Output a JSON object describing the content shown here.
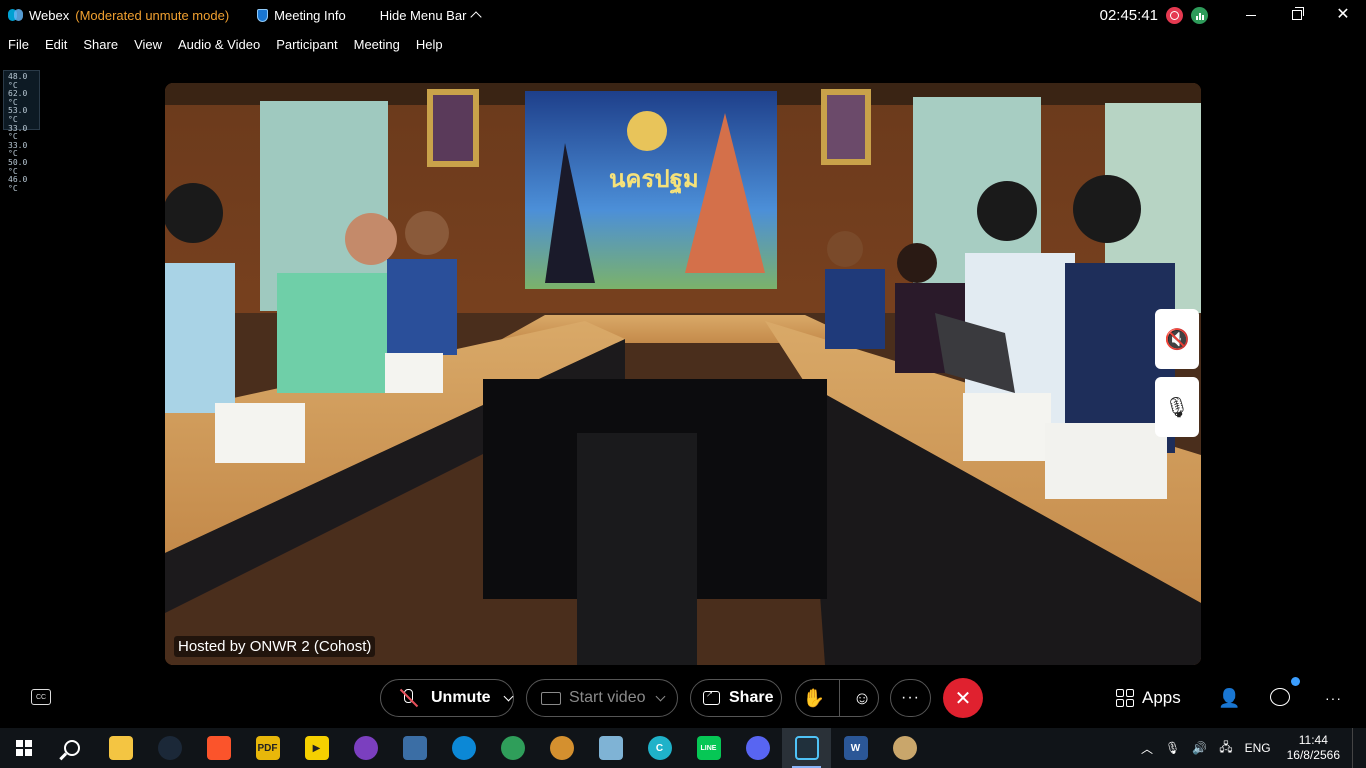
{
  "titlebar": {
    "app_name": "Webex",
    "mode": "(Moderated unmute mode)",
    "meeting_info": "Meeting Info",
    "hide_menu": "Hide Menu Bar",
    "clock": "02:45:41"
  },
  "menu": [
    "File",
    "Edit",
    "Share",
    "View",
    "Audio & Video",
    "Participant",
    "Meeting",
    "Help"
  ],
  "temps": [
    "48.0 °C",
    "62.0 °C",
    "53.0 °C",
    "33.0 °C",
    "33.0 °C",
    "50.0 °C",
    "46.0 °C"
  ],
  "video": {
    "host_label": "Hosted by ONWR 2 (Cohost)",
    "banner_text": "นครปฐม"
  },
  "controls": {
    "unmute": "Unmute",
    "start_video": "Start video",
    "share": "Share",
    "more": "···",
    "apps": "Apps",
    "more_right": "···"
  },
  "taskbar": {
    "apps": [
      {
        "name": "file-explorer",
        "color": "#f4c542"
      },
      {
        "name": "steam",
        "color": "#1b2838"
      },
      {
        "name": "brave",
        "color": "#fb542b"
      },
      {
        "name": "pdf-app",
        "color": "#e8b70a"
      },
      {
        "name": "player",
        "color": "#f5d000"
      },
      {
        "name": "purple-app",
        "color": "#7b3fbf"
      },
      {
        "name": "bird-app",
        "color": "#3b6ea5"
      },
      {
        "name": "edge",
        "color": "#0c88d6"
      },
      {
        "name": "edge-dev",
        "color": "#2f9e5a"
      },
      {
        "name": "eye-app",
        "color": "#d4902f"
      },
      {
        "name": "notes-app",
        "color": "#7fb3d5"
      },
      {
        "name": "canva",
        "color": "#1fb2c9"
      },
      {
        "name": "line",
        "color": "#06c755"
      },
      {
        "name": "discord",
        "color": "#5865f2"
      },
      {
        "name": "webex",
        "color": "#20303c"
      },
      {
        "name": "word",
        "color": "#2b5797"
      },
      {
        "name": "paint",
        "color": "#c9a66b"
      }
    ],
    "lang": "ENG",
    "time": "11:44",
    "date": "16/8/2566"
  }
}
